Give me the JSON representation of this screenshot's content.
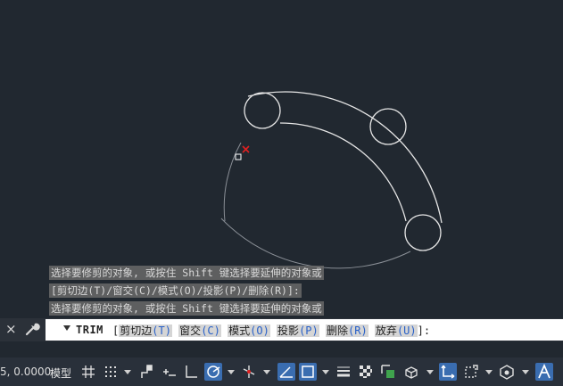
{
  "command_history": [
    "选择要修剪的对象, 或按住 Shift 键选择要延伸的对象或",
    " [剪切边(T)/窗交(C)/模式(O)/投影(P)/删除(R)]:",
    "选择要修剪的对象, 或按住 Shift 键选择要延伸的对象或"
  ],
  "command_line": {
    "close_icon": "×",
    "command": "TRIM",
    "open_bracket": "[",
    "options": [
      {
        "label": "剪切边",
        "key": "(T)"
      },
      {
        "label": "窗交",
        "key": "(C)"
      },
      {
        "label": "模式",
        "key": "(O)"
      },
      {
        "label": "投影",
        "key": "(P)"
      },
      {
        "label": "删除",
        "key": "(R)"
      },
      {
        "label": "放弃",
        "key": "(U)"
      }
    ],
    "close_bracket": "]:"
  },
  "status_bar": {
    "coordinates": "5, 0.0000",
    "model_label": "模型"
  },
  "colors": {
    "canvas_bg": "#212830",
    "geometry": "#e6e6e6",
    "geometry_dim": "#8a8f96",
    "pickbox_marker": "#e02020",
    "active_blue": "#3a6db0"
  }
}
